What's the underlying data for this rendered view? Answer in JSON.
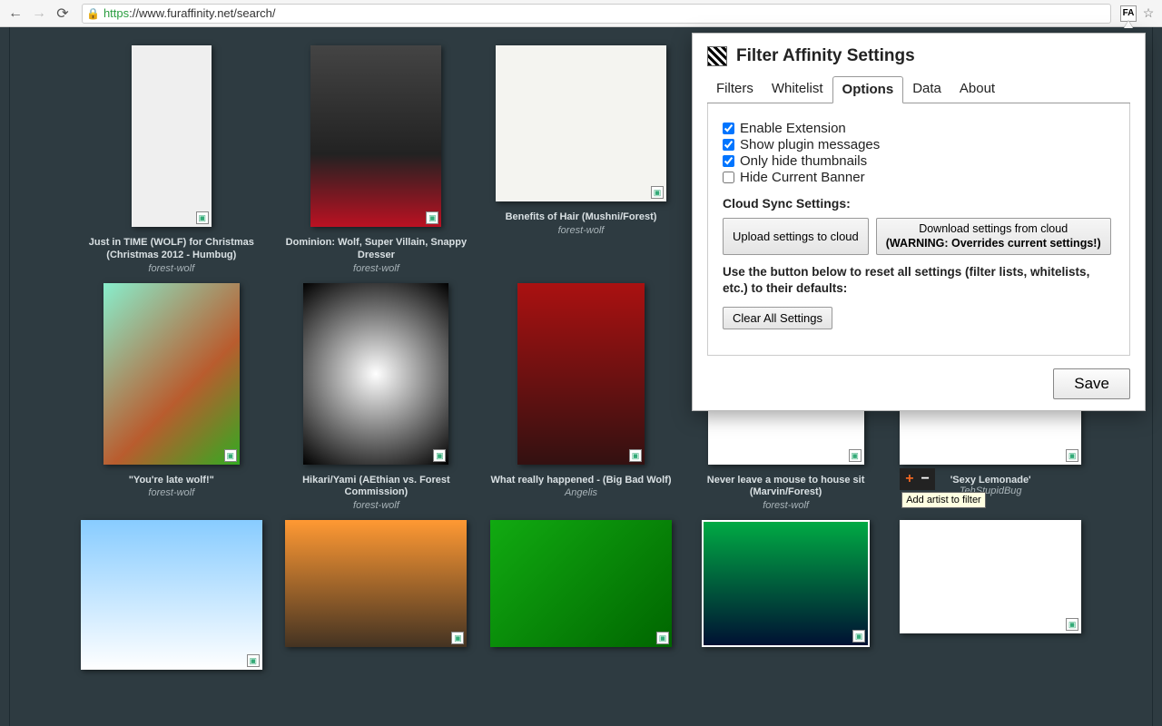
{
  "browser": {
    "url_https": "https",
    "url_rest": "://www.furaffinity.net/search/"
  },
  "gallery": [
    {
      "title": "Just in TIME (WOLF) for Christmas (Christmas 2012 - Humbug)",
      "author": "forest-wolf"
    },
    {
      "title": "Dominion: Wolf, Super Villain, Snappy Dresser",
      "author": "forest-wolf"
    },
    {
      "title": "Benefits of Hair (Mushni/Forest)",
      "author": "forest-wolf"
    },
    {
      "title": "\"You're late wolf!\"",
      "author": "forest-wolf"
    },
    {
      "title": "Hikari/Yami (AEthian vs. Forest Commission)",
      "author": "forest-wolf"
    },
    {
      "title": "What really happened - (Big Bad Wolf)",
      "author": "Angelis"
    },
    {
      "title": "Never leave a mouse to house sit (Marvin/Forest)",
      "author": "forest-wolf"
    },
    {
      "title": "'Sexy Lemonade'",
      "author": "TehStupidBug"
    }
  ],
  "tooltip": "Add artist to filter",
  "popup": {
    "title": "Filter Affinity Settings",
    "tabs": [
      "Filters",
      "Whitelist",
      "Options",
      "Data",
      "About"
    ],
    "active_tab": "Options",
    "options": {
      "enable_extension": {
        "label": "Enable Extension",
        "checked": true
      },
      "show_messages": {
        "label": "Show plugin messages",
        "checked": true
      },
      "only_hide_thumbs": {
        "label": "Only hide thumbnails",
        "checked": true
      },
      "hide_banner": {
        "label": "Hide Current Banner",
        "checked": false
      }
    },
    "cloud_heading": "Cloud Sync Settings:",
    "upload_btn": "Upload settings to cloud",
    "download_btn_line1": "Download settings from cloud",
    "download_btn_line2": "(WARNING: Overrides current settings!)",
    "reset_text": "Use the button below to reset all settings (filter lists, whitelists, etc.) to their defaults:",
    "clear_btn": "Clear All Settings",
    "save_btn": "Save"
  }
}
